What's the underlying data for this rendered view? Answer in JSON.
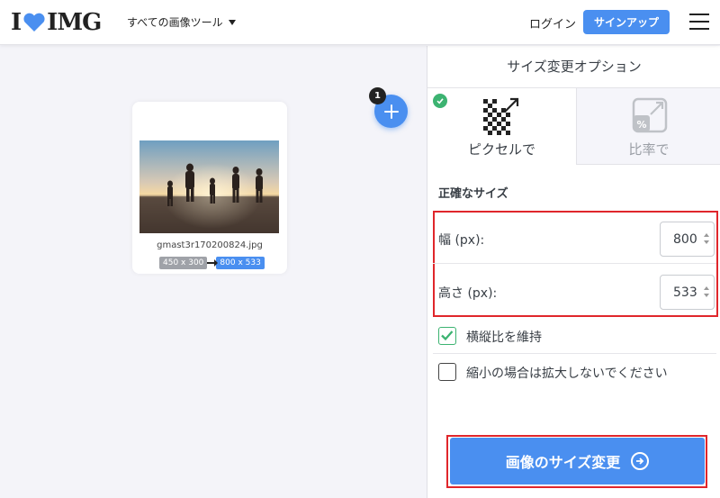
{
  "header": {
    "logo_left": "I",
    "logo_right": "IMG",
    "tools_menu": "すべての画像ツール",
    "login": "ログイン",
    "signup": "サインアップ"
  },
  "workspace": {
    "file_count": "1",
    "file_name": "gmast3r170200824.jpg",
    "original_size": "450 x 300",
    "new_size": "800 x 533"
  },
  "panel": {
    "title": "サイズ変更オプション",
    "tabs": [
      {
        "label": "ピクセルで",
        "selected": true,
        "icon": "pixel-resize-icon"
      },
      {
        "label": "比率で",
        "selected": false,
        "icon": "percent-resize-icon"
      }
    ],
    "section_title": "正確なサイズ",
    "width_label": "幅 (px):",
    "width_value": "800",
    "height_label": "高さ (px):",
    "height_value": "533",
    "keep_ratio_label": "横縦比を維持",
    "keep_ratio_checked": true,
    "no_enlarge_label": "縮小の場合は拡大しないでください",
    "no_enlarge_checked": false,
    "resize_button": "画像のサイズ変更"
  },
  "colors": {
    "accent": "#4a8ff0",
    "highlight": "#e0262b",
    "check": "#3cb371"
  }
}
